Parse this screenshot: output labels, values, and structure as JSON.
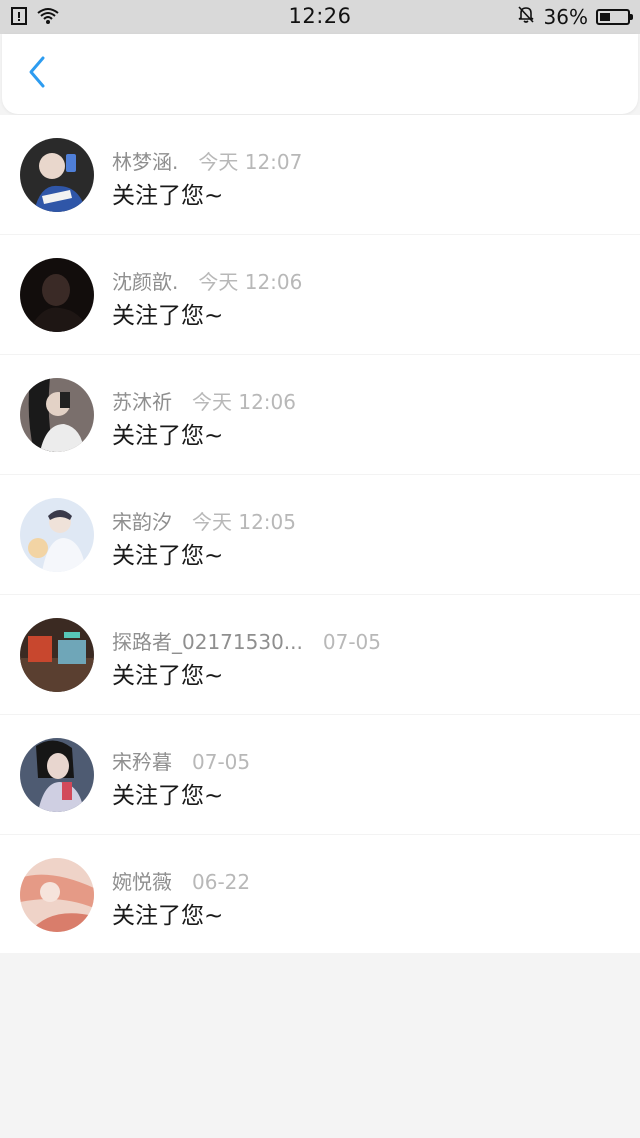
{
  "status_bar": {
    "time": "12:26",
    "battery": "36%",
    "icons": [
      "sim-alert-icon",
      "wifi-icon",
      "mute-bell-icon",
      "battery-icon"
    ]
  },
  "nav": {
    "back_icon": "chevron-left-icon",
    "accent": "#2d9cf0"
  },
  "notifications": [
    {
      "name": "林梦涵.",
      "time": "今天 12:07",
      "message": "关注了您~"
    },
    {
      "name": "沈颜歆.",
      "time": "今天 12:06",
      "message": "关注了您~"
    },
    {
      "name": "苏沐祈",
      "time": "今天 12:06",
      "message": "关注了您~"
    },
    {
      "name": "宋韵汐",
      "time": "今天 12:05",
      "message": "关注了您~"
    },
    {
      "name": "探路者_02171530...",
      "time": "07-05",
      "message": "关注了您~"
    },
    {
      "name": "宋矜暮",
      "time": "07-05",
      "message": "关注了您~"
    },
    {
      "name": "婉悦薇",
      "time": "06-22",
      "message": "关注了您~"
    }
  ]
}
